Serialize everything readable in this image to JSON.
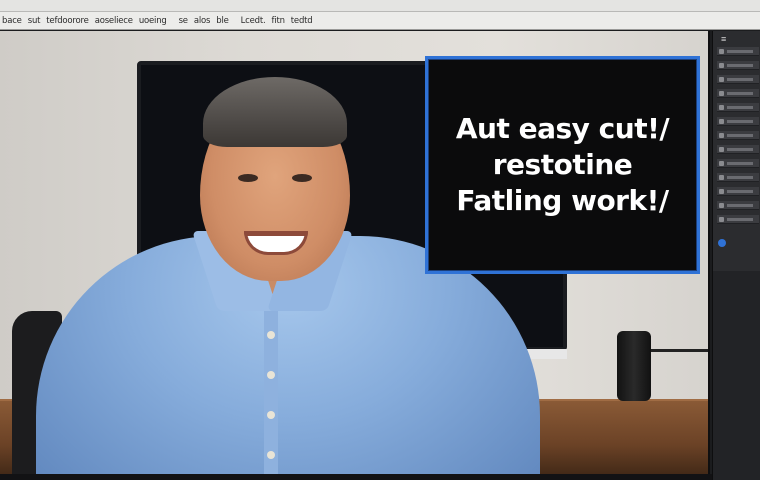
{
  "toolbar": {
    "items": [
      "bace",
      "sut",
      "tefdoorore",
      "aoseliece",
      "uoeing",
      "se",
      "alos",
      "ble",
      "Lcedt.",
      "fitn",
      "tedtd"
    ]
  },
  "overlay": {
    "lines": [
      "Aut easy cut!/",
      "restotine",
      "Fatling work!/"
    ]
  },
  "colors": {
    "overlay_border": "#2f72d6",
    "shirt": "#86acdb",
    "panel": "#2b2c2f"
  },
  "icons": {
    "panel_menu": "menu-icon"
  }
}
